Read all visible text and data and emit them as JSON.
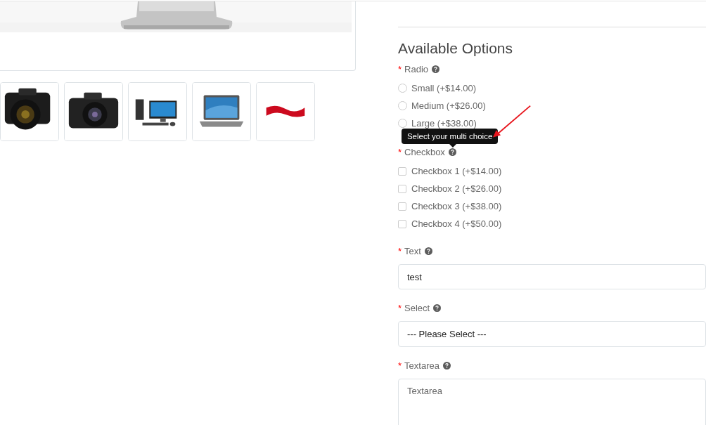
{
  "options": {
    "title": "Available Options",
    "fields": [
      {
        "kind": "radio",
        "label": "Radio",
        "required_mark": "*",
        "help": true,
        "options": [
          {
            "label": "Small (+$14.00)",
            "selected": false
          },
          {
            "label": "Medium (+$26.00)",
            "selected": false
          },
          {
            "label": "Large (+$38.00)",
            "selected": false
          }
        ]
      },
      {
        "kind": "checkbox",
        "label": "Checkbox",
        "required_mark": "*",
        "help": true,
        "tooltip": "Select your multi choice",
        "options": [
          {
            "label": "Checkbox 1 (+$14.00)",
            "checked": false
          },
          {
            "label": "Checkbox 2 (+$26.00)",
            "checked": false
          },
          {
            "label": "Checkbox 3 (+$38.00)",
            "checked": false
          },
          {
            "label": "Checkbox 4 (+$50.00)",
            "checked": false
          }
        ]
      },
      {
        "kind": "text",
        "label": "Text",
        "required_mark": "*",
        "help": true,
        "value": "test"
      },
      {
        "kind": "select",
        "label": "Select",
        "required_mark": "*",
        "help": true,
        "value": "--- Please Select ---"
      },
      {
        "kind": "textarea",
        "label": "Textarea",
        "required_mark": "*",
        "help": true,
        "placeholder": "Textarea"
      }
    ]
  }
}
